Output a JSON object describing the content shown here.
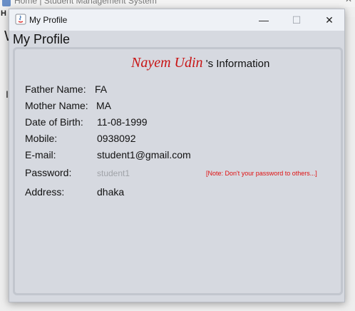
{
  "background": {
    "window_title": "Home | Student Management System",
    "menu_letter": "H",
    "fragment_w": "W",
    "fragment_l": "I"
  },
  "dialog": {
    "title": "My Profile",
    "section_title": "My Profile",
    "controls": {
      "minimize": "—",
      "maximize": "☐",
      "close": "✕"
    }
  },
  "info": {
    "name": "Nayem Udin",
    "suffix": " 's Information"
  },
  "fields": [
    {
      "label": "Father Name:",
      "value": "FA"
    },
    {
      "label": "Mother Name:",
      "value": "MA"
    },
    {
      "label": "Date of Birth:",
      "value": "11-08-1999"
    },
    {
      "label": "Mobile:",
      "value": "0938092"
    },
    {
      "label": "E-mail:",
      "value": "student1@gmail.com"
    },
    {
      "label": "Password:",
      "value": "student1"
    },
    {
      "label": "Address:",
      "value": "dhaka"
    }
  ],
  "note": "[Note: Don't your password to others...]",
  "colors": {
    "name_accent": "#c81414",
    "note": "#e01010"
  }
}
